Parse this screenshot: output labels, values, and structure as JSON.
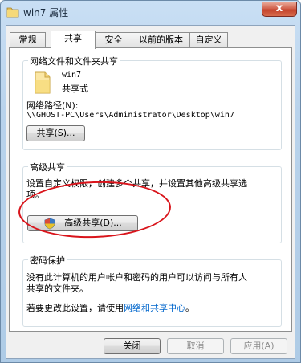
{
  "window": {
    "title": "win7 属性",
    "close_label": "x"
  },
  "tabs": [
    {
      "label": "常规"
    },
    {
      "label": "共享",
      "active": true
    },
    {
      "label": "安全"
    },
    {
      "label": "以前的版本"
    },
    {
      "label": "自定义"
    }
  ],
  "network_sharing": {
    "group_label": "网络文件和文件夹共享",
    "folder_name": "win7",
    "share_state": "共享式",
    "path_label": "网络路径(N):",
    "path_value": "\\\\GHOST-PC\\Users\\Administrator\\Desktop\\win7",
    "share_button": "共享(S)..."
  },
  "advanced_sharing": {
    "group_label": "高级共享",
    "description_line1": "设置自定义权限，创建多个共享，并设置其他高级共享选",
    "description_line2": "项。",
    "button_label": "高级共享(D)..."
  },
  "password_protection": {
    "group_label": "密码保护",
    "line1": "没有此计算机的用户帐户和密码的用户可以访问与所有人",
    "line2": "共享的文件夹。",
    "change_prefix": "若要更改此设置，请使用",
    "change_link": "网络和共享中心",
    "change_suffix": "。"
  },
  "footer": {
    "close_button": "关闭",
    "cancel_button": "取消",
    "apply_button": "应用(A)"
  },
  "colors": {
    "highlight_ellipse": "#d9141b",
    "link": "#0066cc"
  }
}
